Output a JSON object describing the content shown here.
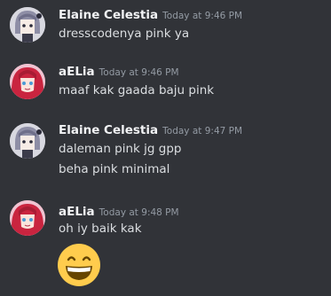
{
  "messages": [
    {
      "author": "Elaine Celestia",
      "timestamp": "Today at 9:46 PM",
      "lines": [
        "dresscodenya pink ya"
      ],
      "avatar_icon": "chibi-grey-hair-avatar"
    },
    {
      "author": "aELia",
      "timestamp": "Today at 9:46 PM",
      "lines": [
        "maaf kak gaada baju pink"
      ],
      "avatar_icon": "anime-red-hair-avatar"
    },
    {
      "author": "Elaine Celestia",
      "timestamp": "Today at 9:47 PM",
      "lines": [
        "daleman pink jg gpp",
        "beha pink minimal"
      ],
      "avatar_icon": "chibi-grey-hair-avatar"
    },
    {
      "author": "aELia",
      "timestamp": "Today at 9:48 PM",
      "lines": [
        "oh iy baik kak"
      ],
      "avatar_icon": "anime-red-hair-avatar",
      "emoji": "grinning-face-emoji"
    }
  ],
  "colors": {
    "background": "#313338",
    "author": "#f2f3f5",
    "timestamp": "#949ba4",
    "text": "#dbdee1"
  }
}
